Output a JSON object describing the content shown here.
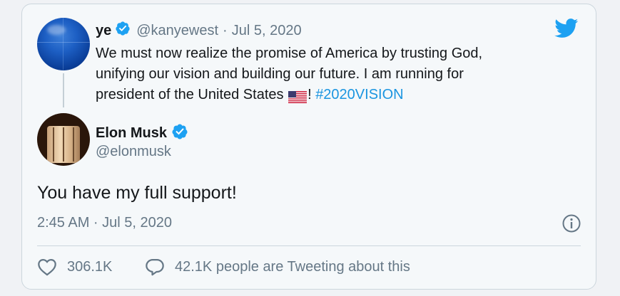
{
  "quoted_tweet": {
    "author_name": "ye",
    "author_handle": "@kanyewest",
    "separator": "·",
    "date": "Jul 5, 2020",
    "text_line1": "We must now realize the promise of America by trusting God,",
    "text_line2": "unifying our vision and building our future. I am running for",
    "text_line3_prefix": "president of the United States ",
    "text_line3_suffix": "! ",
    "hashtag": "#2020VISION"
  },
  "tweet": {
    "author_name": "Elon Musk",
    "author_handle": "@elonmusk",
    "text": "You have my full support!",
    "timestamp": "2:45 AM · Jul 5, 2020"
  },
  "stats": {
    "likes": "306.1K",
    "retweets_text": "42.1K people are Tweeting about this"
  },
  "icons": {
    "brand": "twitter-bird-icon",
    "verified": "verified-badge-icon",
    "info": "info-icon",
    "like": "heart-icon",
    "reply": "speech-bubble-icon",
    "flag": "us-flag-icon"
  },
  "colors": {
    "accent": "#1da1f2",
    "verified": "#1da1f2",
    "hashtag": "#1b95e0",
    "muted": "#657786"
  }
}
